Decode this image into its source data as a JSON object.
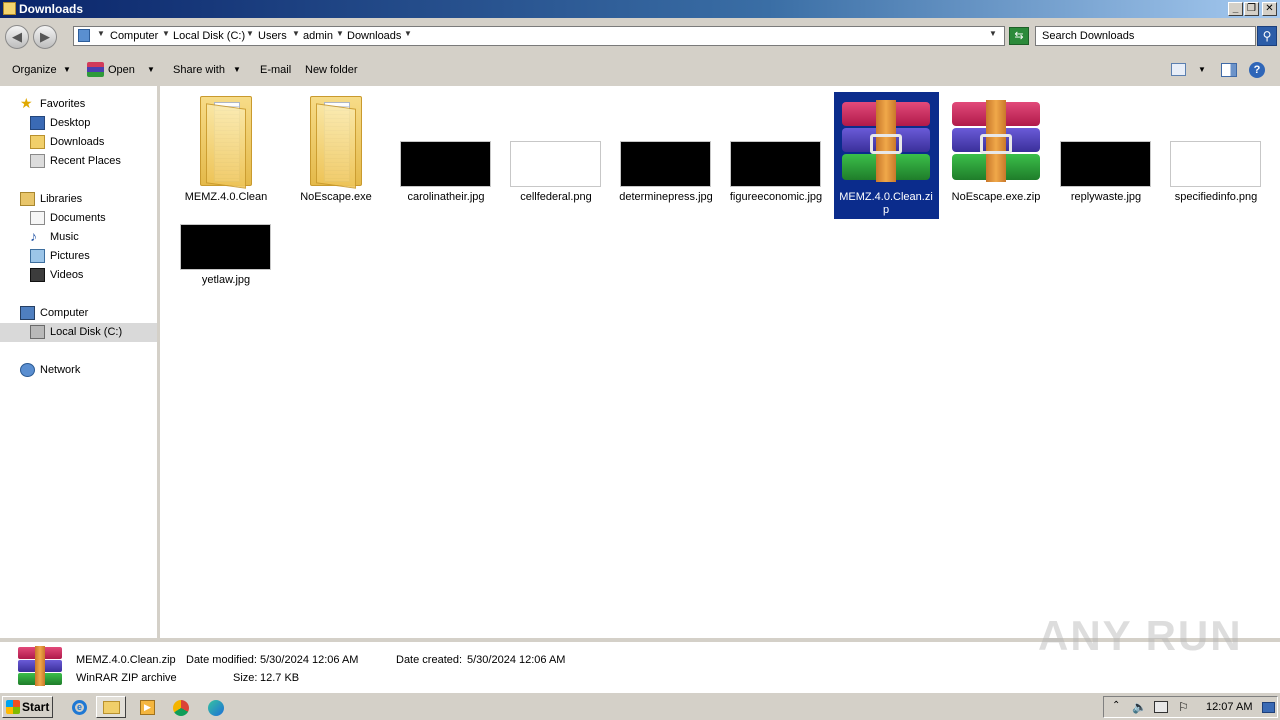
{
  "window": {
    "title": "Downloads"
  },
  "address": {
    "crumbs": [
      "Computer",
      "Local Disk (C:)",
      "Users",
      "admin",
      "Downloads"
    ]
  },
  "search": {
    "placeholder": "Search Downloads"
  },
  "toolbar": {
    "organize": "Organize",
    "open": "Open",
    "share_with": "Share with",
    "email": "E-mail",
    "new_folder": "New folder"
  },
  "nav": {
    "favorites": "Favorites",
    "desktop": "Desktop",
    "downloads": "Downloads",
    "recent_places": "Recent Places",
    "libraries": "Libraries",
    "documents": "Documents",
    "music": "Music",
    "pictures": "Pictures",
    "videos": "Videos",
    "computer": "Computer",
    "local_disk": "Local Disk (C:)",
    "network": "Network"
  },
  "files": [
    {
      "name": "MEMZ.4.0.Clean",
      "kind": "folder"
    },
    {
      "name": "NoEscape.exe",
      "kind": "folder"
    },
    {
      "name": "carolinatheir.jpg",
      "kind": "dark"
    },
    {
      "name": "cellfederal.png",
      "kind": "light"
    },
    {
      "name": "determinepress.jpg",
      "kind": "dark"
    },
    {
      "name": "figureeconomic.jpg",
      "kind": "dark"
    },
    {
      "name": "MEMZ.4.0.Clean.zip",
      "name_line1": "MEMZ.4.0.Clean.zi",
      "name_line2": "p",
      "kind": "rar",
      "selected": true
    },
    {
      "name": "NoEscape.exe.zip",
      "kind": "rar"
    },
    {
      "name": "replywaste.jpg",
      "kind": "dark"
    },
    {
      "name": "specifiedinfo.png",
      "kind": "light"
    },
    {
      "name": "yetlaw.jpg",
      "kind": "dark"
    }
  ],
  "details": {
    "filename": "MEMZ.4.0.Clean.zip",
    "type": "WinRAR ZIP archive",
    "date_modified_label": "Date modified:",
    "date_modified": "5/30/2024 12:06 AM",
    "date_created_label": "Date created:",
    "date_created": "5/30/2024 12:06 AM",
    "size_label": "Size:",
    "size": "12.7 KB"
  },
  "taskbar": {
    "start": "Start",
    "clock": "12:07 AM"
  },
  "watermark": "ANY RUN"
}
